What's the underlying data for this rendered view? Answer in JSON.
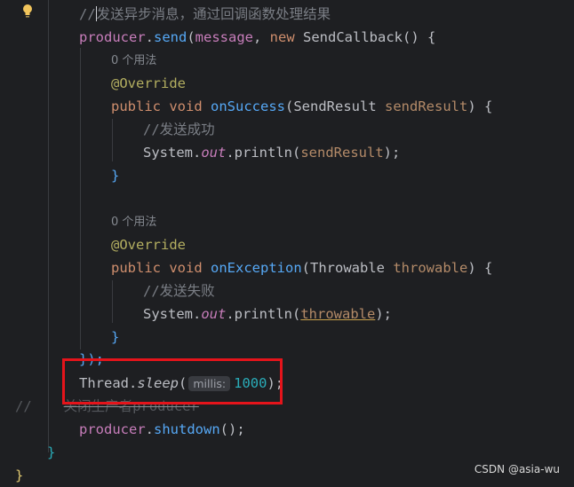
{
  "editor": {
    "gutter_icon": "lightbulb-icon",
    "comment_async": "//发送异步消息，通过回调函数处理结果",
    "send_call": {
      "receiver": "producer",
      "dot": ".",
      "method": "send",
      "paren_open": "(",
      "arg": "message",
      "comma": ", ",
      "kw_new": "new",
      "class_name": " SendCallback",
      "tail": "() {"
    },
    "usage_hint_1": "0 个用法",
    "override_1": "@Override",
    "on_success": {
      "kw_public": "public",
      "kw_void": " void",
      "name": " onSuccess",
      "paren_open": "(",
      "param_type": "SendResult",
      "param_name": " sendResult",
      "tail": ") {"
    },
    "comment_success": "//发送成功",
    "println_1": {
      "cls": "System.",
      "field": "out",
      "mid": ".println(",
      "arg": "sendResult",
      "tail": ");"
    },
    "close_brace_1": "}",
    "usage_hint_2": "0 个用法",
    "override_2": "@Override",
    "on_exception": {
      "kw_public": "public",
      "kw_void": " void",
      "name": " onException",
      "paren_open": "(",
      "param_type": "Throwable",
      "param_name": " throwable",
      "tail": ") {"
    },
    "comment_fail": "//发送失败",
    "println_2": {
      "cls": "System.",
      "field": "out",
      "mid": ".println(",
      "arg": "throwable",
      "tail": ");"
    },
    "close_brace_2": "}",
    "close_call": "});",
    "sleep_call": {
      "cls": "Thread.",
      "method": "sleep",
      "paren_open": "(",
      "hint_label": "millis:",
      "value": "1000",
      "tail": ");"
    },
    "commented_line": {
      "prefix": "//",
      "text": "关闭生产者producer"
    },
    "shutdown_call": {
      "receiver": "producer",
      "dot": ".",
      "method": "shutdown",
      "tail": "();"
    },
    "close_brace_3": "}",
    "close_brace_4": "}"
  },
  "watermark": "CSDN @asia-wu"
}
